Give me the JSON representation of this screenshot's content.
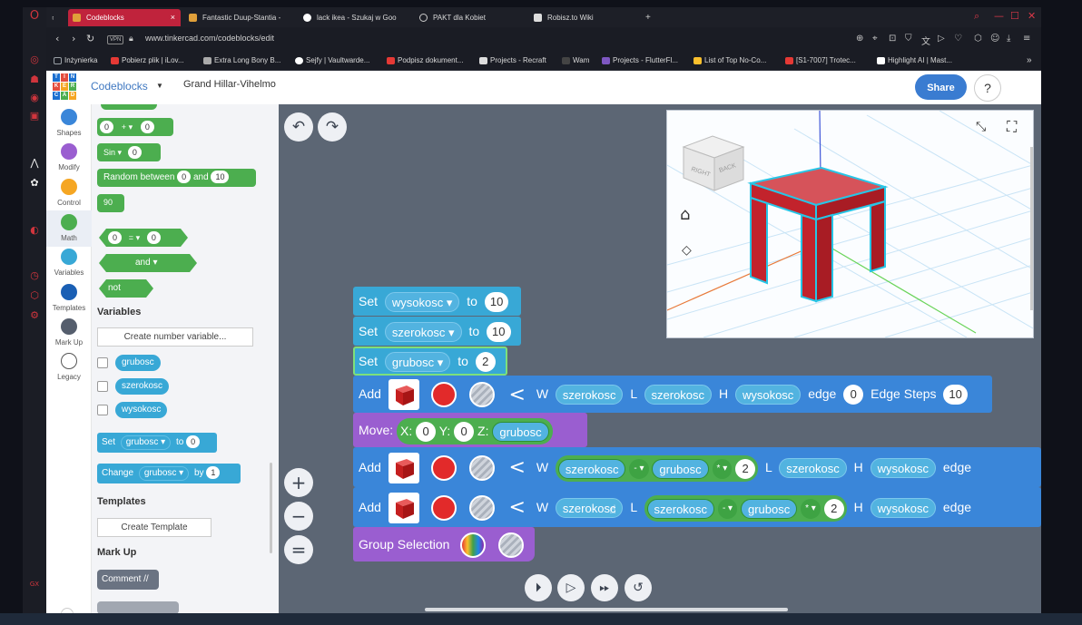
{
  "browser": {
    "tabs": [
      {
        "title": "Codeblocks",
        "fav": "#e0a03a",
        "active": true,
        "close": "×"
      },
      {
        "title": "Fantastic Duup-Stantia -",
        "fav": "#e0a03a"
      },
      {
        "title": "lack ikea - Szukaj w Goo",
        "fav": "#4285f4"
      },
      {
        "title": "PAKT dla Kobiet",
        "fav": "#999999"
      },
      {
        "title": "Robisz.to Wiki",
        "fav": "#666666"
      }
    ],
    "new_tab": "+",
    "vpn_badge": "VPN",
    "url": "www.tinkercad.com/codeblocks/edit",
    "bookmarks": [
      {
        "label": "Inżynierka",
        "fav": "#9aa0a6"
      },
      {
        "label": "Pobierz plik | iLov...",
        "fav": "#e53935"
      },
      {
        "label": "Extra Long Bony B...",
        "fav": "#aaaaaa"
      },
      {
        "label": "Sejfy | Vaultwarde...",
        "fav": "#ffffff"
      },
      {
        "label": "Podpisz dokument...",
        "fav": "#e53935"
      },
      {
        "label": "Projects - Recraft",
        "fav": "#dddddd"
      },
      {
        "label": "Wam",
        "fav": "#444444"
      },
      {
        "label": "Projects - FlutterFl...",
        "fav": "#7e57c2"
      },
      {
        "label": "List of Top No-Co...",
        "fav": "#fbc02d"
      },
      {
        "label": "[S1-7007] Trotec...",
        "fav": "#e53935"
      },
      {
        "label": "Highlight AI | Mast...",
        "fav": "#ffffff"
      }
    ],
    "more_bookmarks": "»"
  },
  "app": {
    "logo_letters": [
      "T",
      "I",
      "N",
      "K",
      "E",
      "R",
      "C",
      "A",
      "D"
    ],
    "codeblocks_menu": "Codeblocks",
    "design_title": "Grand Hillar-Vihelmo",
    "share_label": "Share",
    "help_label": "?"
  },
  "categories": [
    {
      "label": "Shapes",
      "color": "#3a86d9"
    },
    {
      "label": "Modify",
      "color": "#9a5ed0"
    },
    {
      "label": "Control",
      "color": "#f5a623"
    },
    {
      "label": "Math",
      "color": "#4cae4f",
      "selected": true
    },
    {
      "label": "Variables",
      "color": "#38a8d6"
    },
    {
      "label": "Templates",
      "color": "#1a5fb4"
    },
    {
      "label": "Mark Up",
      "color": "#555e6d"
    },
    {
      "label": "Legacy",
      "color": "#ffffff"
    }
  ],
  "palette": {
    "math_blocks": {
      "add_left": "0",
      "add_op": "+",
      "add_right": "0",
      "sin_label": "Sin",
      "sin_value": "0",
      "random_label": "Random between",
      "random_min": "0",
      "random_and": "and",
      "random_max": "10",
      "number_value": "90",
      "compare_left": "0",
      "compare_op": "=",
      "compare_right": "0",
      "logic_and": "and",
      "logic_not": "not"
    },
    "variables_header": "Variables",
    "create_variable_button": "Create number variable...",
    "variables": [
      "grubosc",
      "szerokosc",
      "wysokosc"
    ],
    "set_block": {
      "label": "Set",
      "var": "grubosc",
      "to": "to",
      "value": "0"
    },
    "change_block": {
      "label": "Change",
      "var": "grubosc",
      "by": "by",
      "value": "1"
    },
    "templates_header": "Templates",
    "create_template_button": "Create Template",
    "markup_header": "Mark Up",
    "comment_block": "Comment //"
  },
  "workspace": {
    "undo_icon": "undo-arrow",
    "redo_icon": "redo-arrow",
    "zoom_in": "+",
    "zoom_out": "−",
    "zoom_reset": "=",
    "set_blocks": [
      {
        "label": "Set",
        "var": "wysokosc",
        "to": "to",
        "value": "10"
      },
      {
        "label": "Set",
        "var": "szerokosc",
        "to": "to",
        "value": "10"
      },
      {
        "label": "Set",
        "var": "grubosc",
        "to": "to",
        "value": "2"
      }
    ],
    "add_block_1": {
      "label": "Add",
      "w": "W",
      "w_var": "szerokosc",
      "l": "L",
      "l_var": "szerokosc",
      "h": "H",
      "h_var": "wysokosc",
      "edge": "edge",
      "edge_val": "0",
      "steps": "Edge Steps",
      "steps_val": "10"
    },
    "move_block": {
      "label": "Move:",
      "x": "X:",
      "x_val": "0",
      "y": "Y:",
      "y_val": "0",
      "z": "Z:",
      "z_var": "grubosc"
    },
    "add_block_2": {
      "label": "Add",
      "w": "W",
      "w_a": "szerokosc",
      "op1": "-",
      "w_b": "grubosc",
      "op2": "*",
      "w_c": "2",
      "l": "L",
      "l_var": "szerokosc",
      "h": "H",
      "h_var": "wysokosc",
      "edge": "edge"
    },
    "add_block_3": {
      "label": "Add",
      "w": "W",
      "w_var": "szerokosc",
      "l": "L",
      "l_a": "szerokosc",
      "op1": "-",
      "l_b": "grubosc",
      "op2": "*",
      "l_c": "2",
      "h": "H",
      "h_var": "wysokosc",
      "edge": "edge"
    },
    "group_block": {
      "label": "Group Selection"
    }
  },
  "viewport": {
    "viewcube_faces": [
      "RIGHT",
      "BACK"
    ],
    "shape_color": "#d0262f"
  },
  "playback": [
    "step",
    "play",
    "fast-forward",
    "reset"
  ]
}
